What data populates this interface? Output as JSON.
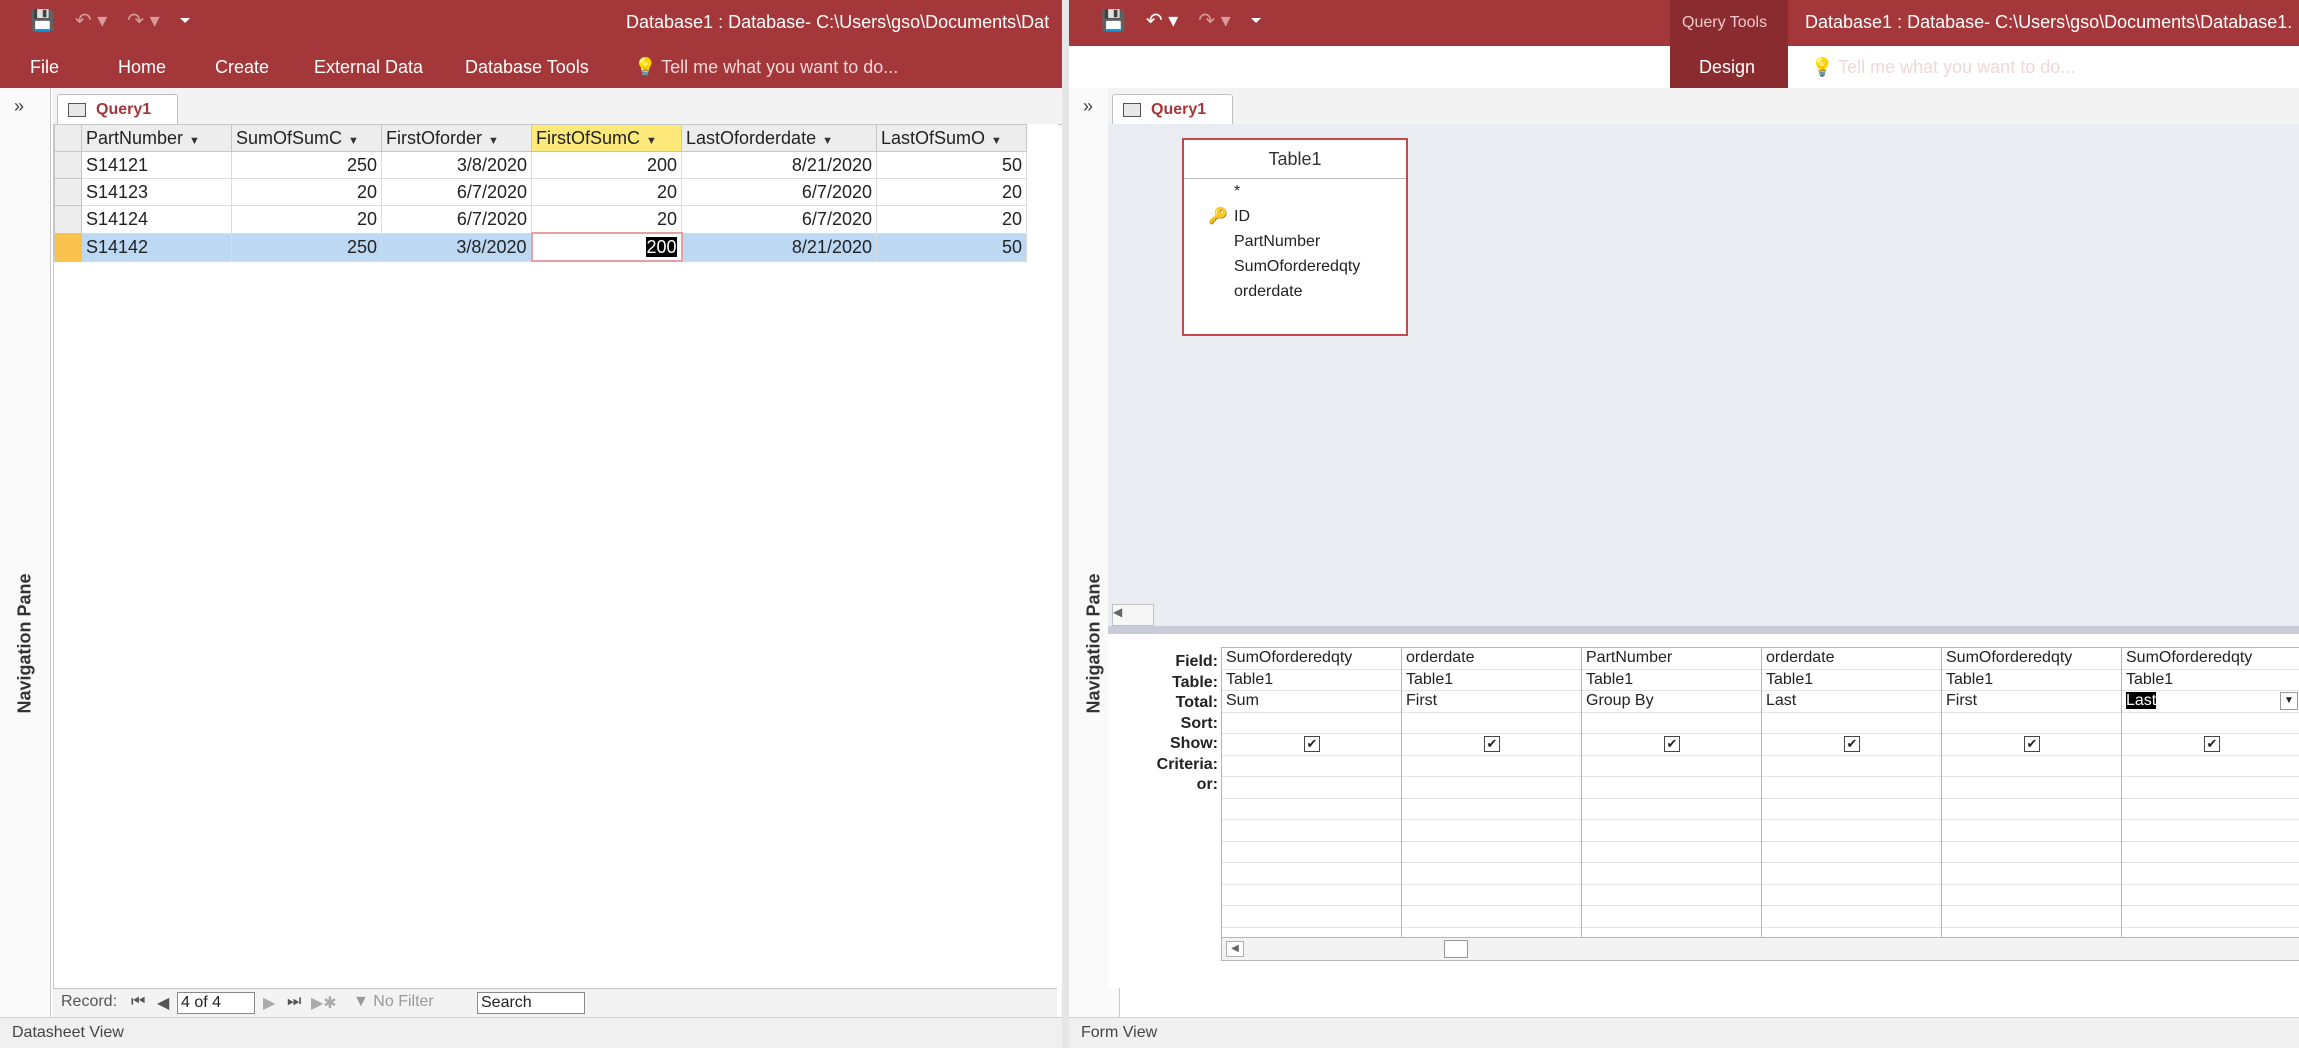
{
  "left": {
    "title": "Database1 : Database- C:\\Users\\gso\\Documents\\Dat",
    "tabs": [
      "File",
      "Home",
      "Create",
      "External Data",
      "Database Tools"
    ],
    "tellme": "Tell me what you want to do...",
    "nav_pane": "Navigation Pane",
    "doc_tab": "Query1",
    "columns": [
      "PartNumber",
      "SumOfSumC",
      "FirstOforder",
      "FirstOfSumC",
      "LastOforderdate",
      "LastOfSumO"
    ],
    "rows": [
      [
        "S14121",
        "250",
        "3/8/2020",
        "200",
        "8/21/2020",
        "50"
      ],
      [
        "S14123",
        "20",
        "6/7/2020",
        "20",
        "6/7/2020",
        "20"
      ],
      [
        "S14124",
        "20",
        "6/7/2020",
        "20",
        "6/7/2020",
        "20"
      ],
      [
        "S14142",
        "250",
        "3/8/2020",
        "200",
        "8/21/2020",
        "50"
      ]
    ],
    "record_label": "Record:",
    "record_position": "4 of 4",
    "filter_label": "No Filter",
    "search_label": "Search",
    "status": "Datasheet View"
  },
  "right": {
    "title": "Database1 : Database- C:\\Users\\gso\\Documents\\Database1.",
    "tabs": [
      "File",
      "Home",
      "Create",
      "External Data",
      "Database Tools",
      "Design"
    ],
    "context_label": "Query Tools",
    "tellme": "Tell me what you want to do...",
    "nav_pane": "Navigation Pane",
    "doc_tab": "Query1",
    "table_name": "Table1",
    "table_fields": [
      "*",
      "ID",
      "PartNumber",
      "SumOforderedqty",
      "orderdate"
    ],
    "row_labels": [
      "Field:",
      "Table:",
      "Total:",
      "Sort:",
      "Show:",
      "Criteria:",
      "or:"
    ],
    "qbe_columns": [
      {
        "field": "SumOforderedqty",
        "table": "Table1",
        "total": "Sum"
      },
      {
        "field": "orderdate",
        "table": "Table1",
        "total": "First"
      },
      {
        "field": "PartNumber",
        "table": "Table1",
        "total": "Group By"
      },
      {
        "field": "orderdate",
        "table": "Table1",
        "total": "Last"
      },
      {
        "field": "SumOforderedqty",
        "table": "Table1",
        "total": "First"
      },
      {
        "field": "SumOforderedqty",
        "table": "Table1",
        "total": "Last"
      }
    ],
    "status": "Form View"
  }
}
